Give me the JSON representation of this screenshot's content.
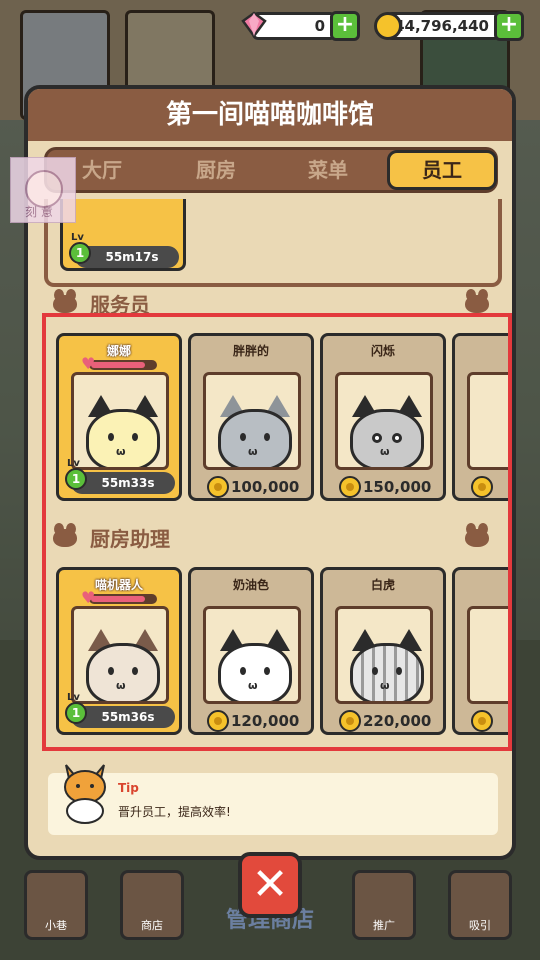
{
  "currency": {
    "gems": "0",
    "coins": "44,796,440"
  },
  "panel": {
    "title": "第一间喵喵咖啡馆",
    "tabs": [
      "大厅",
      "厨房",
      "菜单",
      "员工"
    ],
    "active_tab": "员工"
  },
  "top_card": {
    "timer": "55m17s",
    "lv_label": "Lv",
    "level": "1"
  },
  "sections": [
    {
      "label": "服务员",
      "cards": [
        {
          "name": "娜娜",
          "owned": true,
          "timer": "55m33s",
          "level": "1",
          "lv_label": "Lv",
          "heart_fill": 0.85
        },
        {
          "name": "胖胖的",
          "owned": false,
          "price": "100,000"
        },
        {
          "name": "闪烁",
          "owned": false,
          "price": "150,000"
        },
        {
          "name": "",
          "owned": false,
          "price": ""
        }
      ]
    },
    {
      "label": "厨房助理",
      "cards": [
        {
          "name": "喵机器人",
          "owned": true,
          "timer": "55m36s",
          "level": "1",
          "lv_label": "Lv",
          "heart_fill": 0.85
        },
        {
          "name": "奶油色",
          "owned": false,
          "price": "120,000"
        },
        {
          "name": "白虎",
          "owned": false,
          "price": "220,000"
        },
        {
          "name": "",
          "owned": false,
          "price": ""
        }
      ]
    }
  ],
  "tip": {
    "title": "Tip",
    "text": "晋升员工，提高效率!"
  },
  "bottom_nav": {
    "items": [
      "小巷",
      "商店",
      "推广",
      "吸引"
    ],
    "center_text": "管理商店"
  },
  "thumbnail_text": "刻 意",
  "colors": {
    "panel_bg": "#ead9b5",
    "header_brown": "#8a5c42",
    "owned_card": "#f6c246",
    "close_red": "#e24a3c",
    "highlight_red": "#e3393c"
  }
}
